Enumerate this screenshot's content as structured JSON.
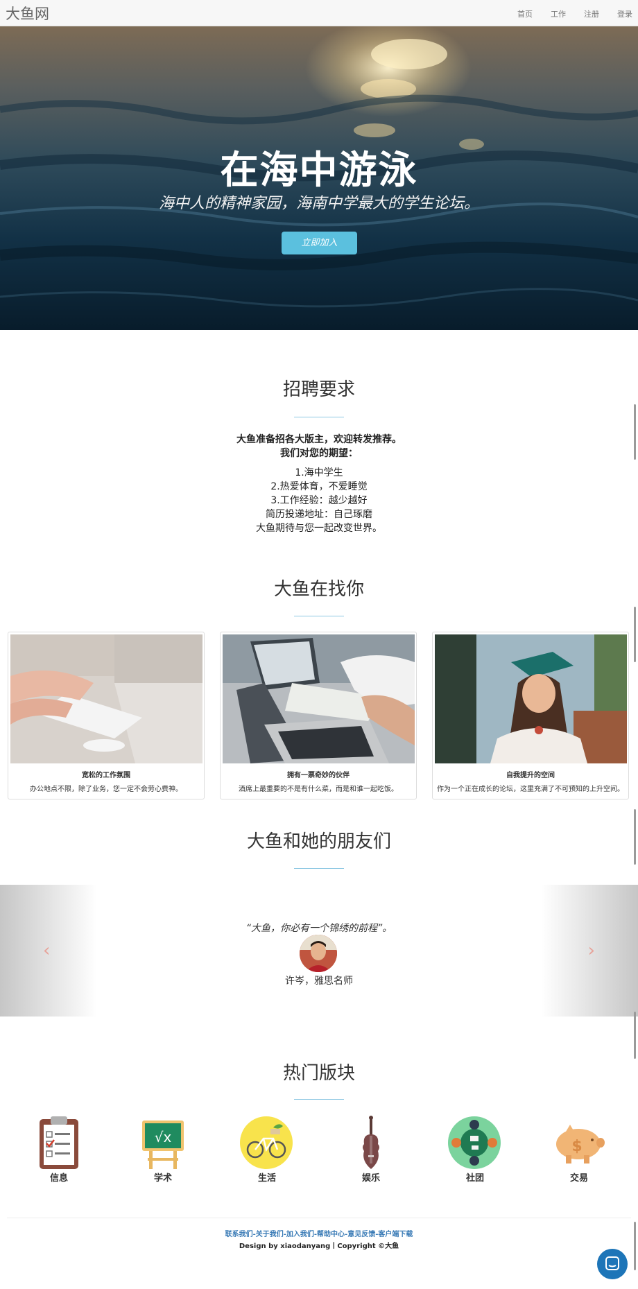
{
  "nav": {
    "brand": "大鱼网",
    "links": [
      "首页",
      "工作",
      "注册",
      "登录"
    ]
  },
  "hero": {
    "title": "在海中游泳",
    "subtitle": "海中人的精神家园，海南中学最大的学生论坛。",
    "button": "立即加入"
  },
  "recruit": {
    "title": "招聘要求",
    "lines": [
      "大鱼准备招各大版主，欢迎转发推荐。",
      "我们对您的期望：",
      "1.海中学生",
      "2.热爱体育，不爱睡觉",
      "3.工作经验：越少越好",
      "简历投递地址：自己琢磨",
      "大鱼期待与您一起改变世界。"
    ]
  },
  "looking": {
    "title": "大鱼在找你",
    "cards": [
      {
        "title": "宽松的工作氛围",
        "desc": "办公地点不限，除了业务，您一定不会劳心费神。"
      },
      {
        "title": "拥有一票奇妙的伙伴",
        "desc": "酒席上最重要的不是有什么菜，而是和谁一起吃饭。"
      },
      {
        "title": "自我提升的空间",
        "desc": "作为一个正在成长的论坛，这里充满了不可预知的上升空间。"
      }
    ]
  },
  "friends": {
    "title": "大鱼和她的朋友们",
    "quote": "“大鱼，你必有一个锦绣的前程”。",
    "name": "许岑，雅思名师",
    "prev": "‹",
    "next": "›"
  },
  "hot": {
    "title": "热门版块",
    "items": [
      {
        "label": "信息",
        "icon": "clipboard-icon"
      },
      {
        "label": "学术",
        "icon": "chalkboard-sqrt-icon"
      },
      {
        "label": "生活",
        "icon": "bicycle-icon"
      },
      {
        "label": "娱乐",
        "icon": "violin-icon"
      },
      {
        "label": "社团",
        "icon": "meeting-table-icon"
      },
      {
        "label": "交易",
        "icon": "piggy-bank-icon"
      }
    ]
  },
  "footer": {
    "links": "联系我们-关于我们-加入我们-帮助中心-意见反馈-客户端下载",
    "copyright": "Design by xiaodanyang丨Copyright ©大鱼"
  },
  "colors": {
    "accent": "#5bc0de",
    "rule": "#8cc7e2",
    "chat": "#1d75b8",
    "link": "#3779b5"
  }
}
